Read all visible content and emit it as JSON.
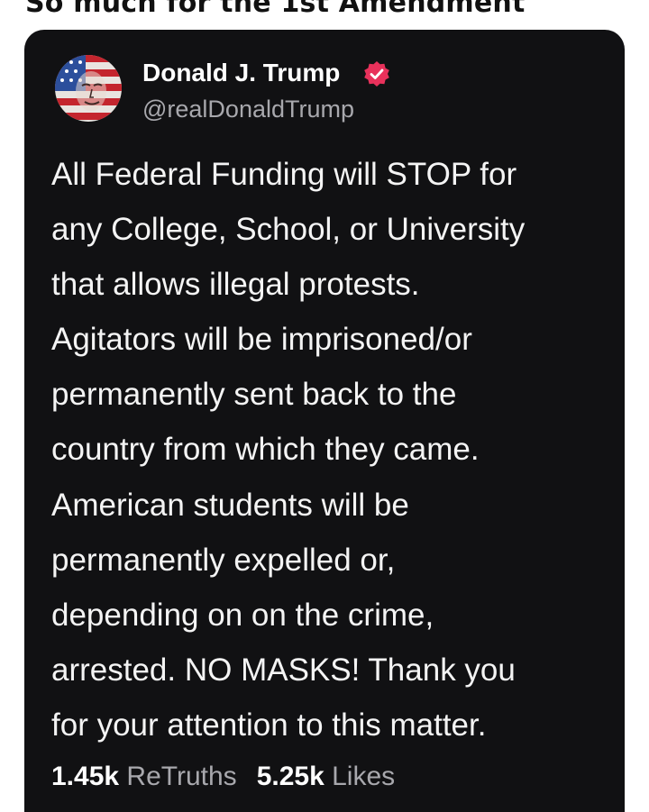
{
  "caption": "So much for the 1st Amendment",
  "post": {
    "author": {
      "display_name": "Donald J. Trump",
      "handle": "@realDonaldTrump",
      "verified_icon": "verified-badge-icon",
      "avatar_icon": "flag-portrait-avatar"
    },
    "text_lines": [
      "All Federal Funding will STOP for",
      "any College, School, or University",
      "that allows illegal protests.",
      "Agitators will be imprisoned/or",
      "permanently sent back to the",
      "country from which they came.",
      "American students will be",
      "permanently expelled or,",
      "depending on on the crime,",
      "arrested. NO MASKS! Thank you",
      "for your attention to this matter."
    ],
    "stats": {
      "retruths_count": "1.45k",
      "retruths_label": "ReTruths",
      "likes_count": "5.25k",
      "likes_label": "Likes"
    }
  },
  "colors": {
    "card_background": "#111113",
    "verified_badge": "#e8315b",
    "secondary_text": "#a8a8ad"
  }
}
